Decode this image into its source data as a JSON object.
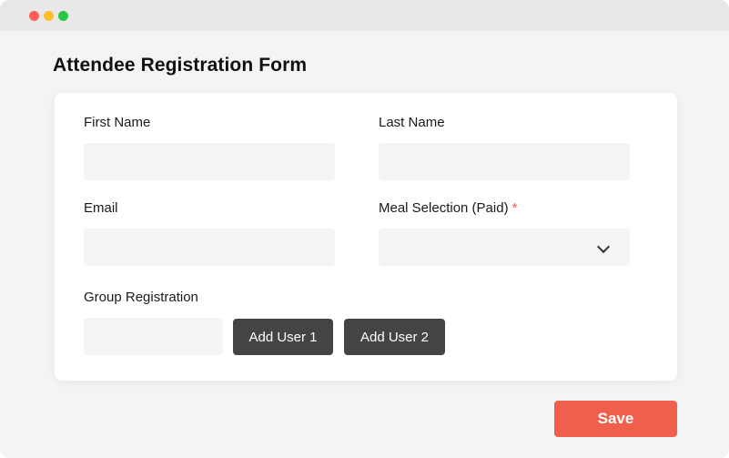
{
  "window": {
    "controls": [
      "close",
      "minimize",
      "maximize"
    ]
  },
  "form": {
    "title": "Attendee Registration Form",
    "first_name_label": "First Name",
    "last_name_label": "Last Name",
    "email_label": "Email",
    "meal_label": "Meal Selection (Paid)",
    "meal_required_mark": "*",
    "group_label": "Group Registration",
    "add_user_1_label": "Add User 1",
    "add_user_2_label": "Add User 2",
    "first_name_value": "",
    "last_name_value": "",
    "email_value": "",
    "meal_value": "",
    "group_value": ""
  },
  "actions": {
    "save_label": "Save"
  },
  "colors": {
    "accent": "#f05f4b",
    "button_dark": "#444444",
    "required": "#f05a45",
    "field_bg": "#f4f4f4"
  },
  "icons": {
    "select_arrow": "chevron-down-icon"
  }
}
